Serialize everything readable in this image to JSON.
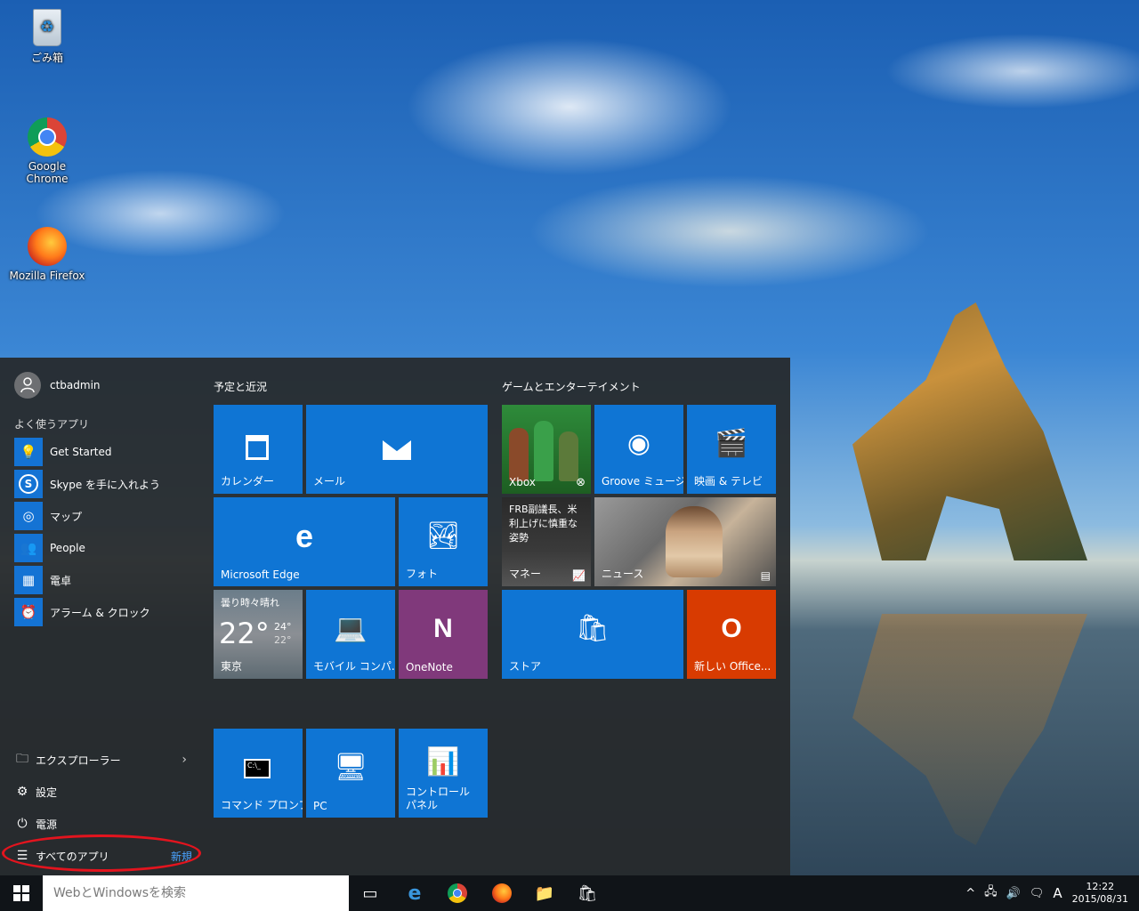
{
  "desktop": {
    "icons": [
      {
        "label": "ごみ箱",
        "icon": "recycle-bin-icon"
      },
      {
        "label": "Google Chrome",
        "icon": "chrome-icon"
      },
      {
        "label": "Mozilla Firefox",
        "icon": "firefox-icon"
      }
    ]
  },
  "start_menu": {
    "user_name": "ctbadmin",
    "frequent_label": "よく使うアプリ",
    "frequent_apps": [
      {
        "label": "Get Started",
        "icon": "lightbulb-icon"
      },
      {
        "label": "Skype を手に入れよう",
        "icon": "skype-icon"
      },
      {
        "label": "マップ",
        "icon": "map-icon"
      },
      {
        "label": "People",
        "icon": "people-icon"
      },
      {
        "label": "電卓",
        "icon": "calculator-icon"
      },
      {
        "label": "アラーム & クロック",
        "icon": "alarm-clock-icon"
      }
    ],
    "bottom_items": {
      "explorer": "エクスプローラー",
      "settings": "設定",
      "power": "電源",
      "all_apps": "すべてのアプリ",
      "new_badge": "新規"
    },
    "groups": {
      "left_title": "予定と近況",
      "right_title": "ゲームとエンターテイメント"
    },
    "tiles": {
      "calendar": "カレンダー",
      "mail": "メール",
      "xbox": "Xbox",
      "groove": "Groove ミュージ...",
      "movies": "映画 & テレビ",
      "edge": "Microsoft Edge",
      "photos": "フォト",
      "money_headline": "FRB副議長、米利上げに慎重な姿勢",
      "money": "マネー",
      "news": "ニュース",
      "weather_desc": "曇り時々晴れ",
      "weather_temp": "22°",
      "weather_high": "24°",
      "weather_low": "22°",
      "weather_city": "東京",
      "mobile": "モバイル コンパ...",
      "onenote": "OneNote",
      "store": "ストア",
      "office": "新しい Office...",
      "cmd": "コマンド プロンプト",
      "pc": "PC",
      "control_panel": "コントロール パネル"
    }
  },
  "taskbar": {
    "search_placeholder": "WebとWindowsを検索",
    "ime": "A",
    "time": "12:22",
    "date": "2015/08/31"
  },
  "colors": {
    "tile_blue": "#0f75d4",
    "onenote": "#80397b",
    "office": "#d83b01",
    "highlight_circle": "#e3141e"
  }
}
